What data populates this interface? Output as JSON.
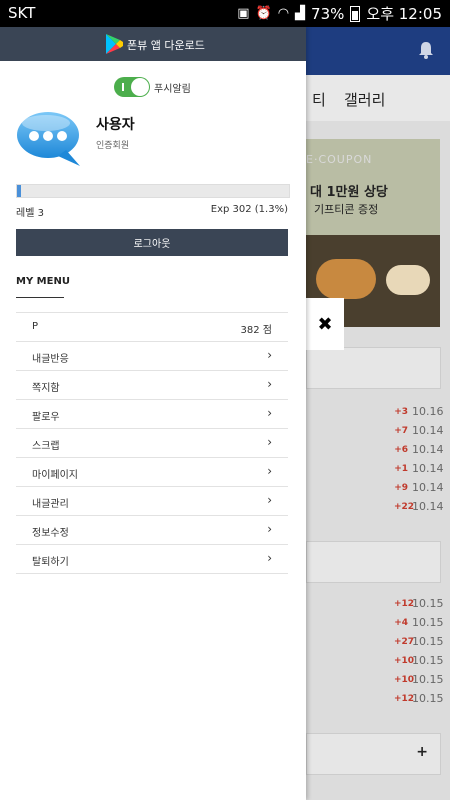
{
  "status_bar": {
    "carrier": "SKT",
    "battery_percent": "73%",
    "time": "오후 12:05"
  },
  "drawer": {
    "top_banner": "폰뷰 앱 다운로드",
    "push_label": "푸시알림",
    "push_toggle_state": "on",
    "user": {
      "name": "사용자",
      "role": "인증회원"
    },
    "progress_fraction": 0.013,
    "level_text": "레벨 3",
    "exp_text": "Exp 302 (1.3%)",
    "logout_label": "로그아웃",
    "menu_title": "MY MENU",
    "menu": [
      {
        "label": "P",
        "value": "382 점"
      },
      {
        "label": "내글반응"
      },
      {
        "label": "쪽지함"
      },
      {
        "label": "팔로우"
      },
      {
        "label": "스크랩"
      },
      {
        "label": "마이페이지"
      },
      {
        "label": "내글관리"
      },
      {
        "label": "정보수정"
      },
      {
        "label": "탈퇴하기"
      }
    ]
  },
  "background": {
    "tabs": [
      "티",
      "갤러리"
    ],
    "banner": {
      "coupon_text": "E·COUPON",
      "line1": "대 1만원 상당",
      "line2": "기프티콘 증정"
    },
    "list1": [
      {
        "count": "+3",
        "date": "10.16"
      },
      {
        "count": "+7",
        "date": "10.14"
      },
      {
        "count": "+6",
        "date": "10.14"
      },
      {
        "count": "+1",
        "date": "10.14"
      },
      {
        "count": "+9",
        "date": "10.14"
      },
      {
        "count": "+22",
        "date": "10.14"
      }
    ],
    "list2": [
      {
        "count": "+12",
        "date": "10.15"
      },
      {
        "count": "+4",
        "date": "10.15"
      },
      {
        "count": "+27",
        "date": "10.15"
      },
      {
        "count": "+10",
        "date": "10.15"
      },
      {
        "count": "+10",
        "date": "10.15"
      },
      {
        "count": "+12",
        "date": "10.15"
      }
    ],
    "plus_label": "+"
  },
  "close_icon_char": "✖",
  "colors": {
    "header_blue": "#1e3d80",
    "drawer_dark": "#3a4555",
    "toggle_green": "#4cae4c",
    "count_red": "#c0392b"
  }
}
